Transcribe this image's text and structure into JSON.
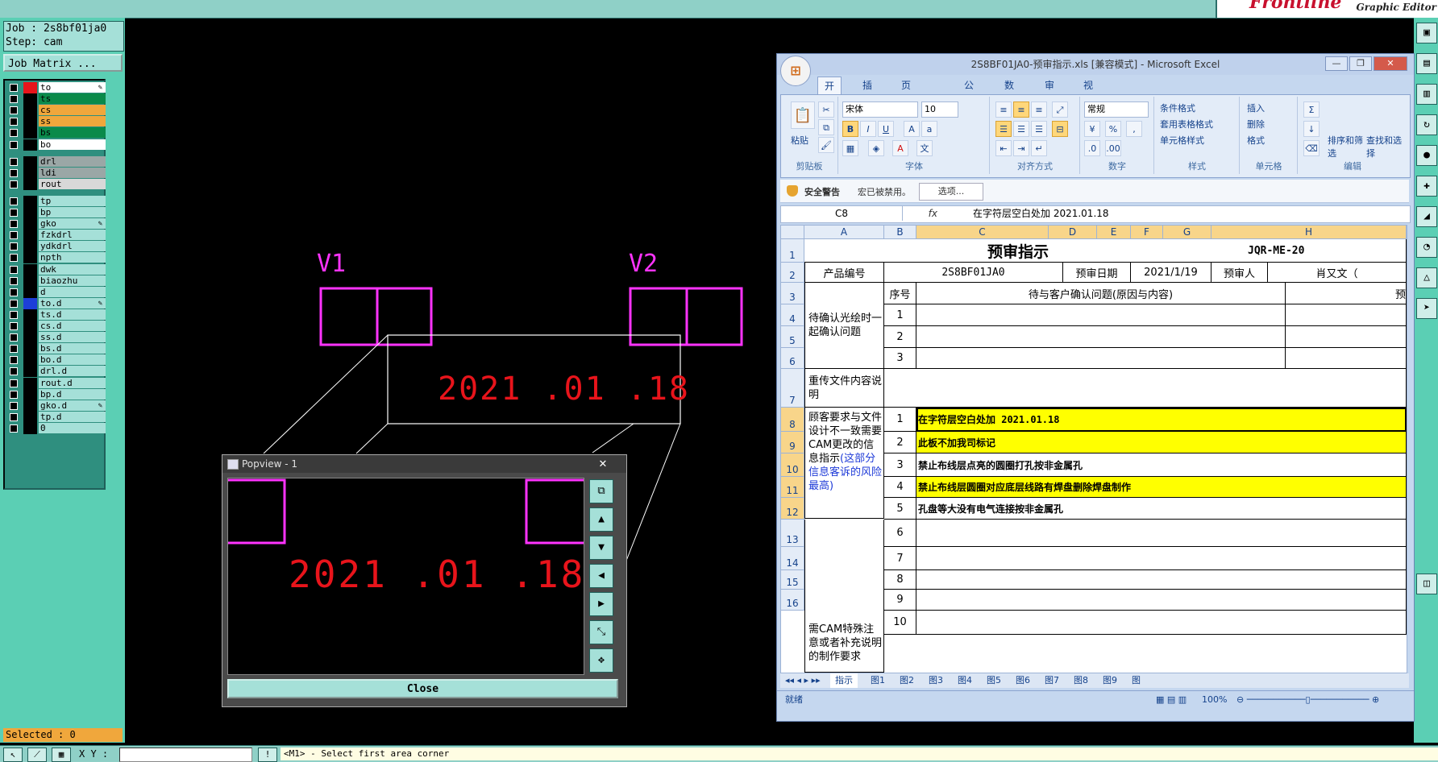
{
  "app": {
    "brand_logo": "Frontline",
    "brand_subtitle": "Graphic Editor"
  },
  "job": {
    "job_line": "Job : 2s8bf01ja0",
    "step_line": "Step: cam",
    "matrix_button": "Job Matrix ..."
  },
  "layers": [
    {
      "name": "to",
      "color": "#ffffff",
      "swatch": "#e8141b",
      "pen": true,
      "group": 0
    },
    {
      "name": "ts",
      "color": "#0a8a4a",
      "swatch": "#000",
      "pen": false,
      "group": 0
    },
    {
      "name": "cs",
      "color": "#f0a73c",
      "swatch": "#000",
      "pen": false,
      "group": 0
    },
    {
      "name": "ss",
      "color": "#f0a73c",
      "swatch": "#000",
      "pen": false,
      "group": 0
    },
    {
      "name": "bs",
      "color": "#0a8a4a",
      "swatch": "#000",
      "pen": false,
      "group": 0
    },
    {
      "name": "bo",
      "color": "#ffffff",
      "swatch": "#000",
      "pen": false,
      "group": 0
    },
    {
      "name": "drl",
      "color": "#9aa7a6",
      "swatch": "#000",
      "pen": false,
      "group": 1
    },
    {
      "name": "ldi",
      "color": "#9aa7a6",
      "swatch": "#000",
      "pen": false,
      "group": 1
    },
    {
      "name": "rout",
      "color": "#d8d8d8",
      "swatch": "#000",
      "pen": false,
      "group": 1
    },
    {
      "name": "tp",
      "color": "#a5e0d8",
      "swatch": "#000",
      "pen": false,
      "group": 2
    },
    {
      "name": "bp",
      "color": "#a5e0d8",
      "swatch": "#000",
      "pen": false,
      "group": 2
    },
    {
      "name": "gko",
      "color": "#a5e0d8",
      "swatch": "#000",
      "pen": true,
      "group": 2
    },
    {
      "name": "fzkdrl",
      "color": "#a5e0d8",
      "swatch": "#000",
      "pen": false,
      "group": 2
    },
    {
      "name": "ydkdrl",
      "color": "#a5e0d8",
      "swatch": "#000",
      "pen": false,
      "group": 2
    },
    {
      "name": "npth",
      "color": "#a5e0d8",
      "swatch": "#000",
      "pen": false,
      "group": 2
    },
    {
      "name": "dwk",
      "color": "#a5e0d8",
      "swatch": "#000",
      "pen": false,
      "group": 2
    },
    {
      "name": "biaozhu",
      "color": "#a5e0d8",
      "swatch": "#000",
      "pen": false,
      "group": 2
    },
    {
      "name": "d",
      "color": "#a5e0d8",
      "swatch": "#000",
      "pen": false,
      "group": 2
    },
    {
      "name": "to.d",
      "color": "#a5e0d8",
      "swatch": "#1d3fd8",
      "pen": true,
      "group": 2
    },
    {
      "name": "ts.d",
      "color": "#a5e0d8",
      "swatch": "#000",
      "pen": false,
      "group": 2
    },
    {
      "name": "cs.d",
      "color": "#a5e0d8",
      "swatch": "#000",
      "pen": false,
      "group": 2
    },
    {
      "name": "ss.d",
      "color": "#a5e0d8",
      "swatch": "#000",
      "pen": false,
      "group": 2
    },
    {
      "name": "bs.d",
      "color": "#a5e0d8",
      "swatch": "#000",
      "pen": false,
      "group": 2
    },
    {
      "name": "bo.d",
      "color": "#a5e0d8",
      "swatch": "#000",
      "pen": false,
      "group": 2
    },
    {
      "name": "drl.d",
      "color": "#a5e0d8",
      "swatch": "#000",
      "pen": false,
      "group": 2
    },
    {
      "name": "rout.d",
      "color": "#a5e0d8",
      "swatch": "#000",
      "pen": false,
      "group": 2
    },
    {
      "name": "bp.d",
      "color": "#a5e0d8",
      "swatch": "#000",
      "pen": false,
      "group": 2
    },
    {
      "name": "gko.d",
      "color": "#a5e0d8",
      "swatch": "#000",
      "pen": true,
      "group": 2
    },
    {
      "name": "tp.d",
      "color": "#a5e0d8",
      "swatch": "#000",
      "pen": false,
      "group": 2
    },
    {
      "name": "0",
      "color": "#a5e0d8",
      "swatch": "#000",
      "pen": false,
      "group": 2
    }
  ],
  "selected": "Selected : 0",
  "canvas": {
    "label_v1": "V1",
    "label_v2": "V2",
    "date_text": "2021 .01 .18"
  },
  "popview": {
    "title": "Popview - 1",
    "close_label": "Close",
    "date_text": "2021 .01 .18"
  },
  "bottom": {
    "xy_label": "X Y :",
    "message": "<M1> - Select first area corner"
  },
  "excel": {
    "title": "2S8BF01JA0-预审指示.xls  [兼容模式]  -  Microsoft Excel",
    "tabs": [
      "开始",
      "插入",
      "页面布局",
      "公式",
      "数据",
      "审阅",
      "视图"
    ],
    "font_name": "宋体",
    "font_size": "10",
    "number_format": "常规",
    "ribbon_groups": [
      "剪贴板",
      "字体",
      "对齐方式",
      "数字",
      "样式",
      "单元格",
      "编辑"
    ],
    "paste_label": "粘贴",
    "style_items": [
      "条件格式",
      "套用表格格式",
      "单元格样式"
    ],
    "cell_items": [
      "插入",
      "删除",
      "格式"
    ],
    "edit_items": [
      "排序和筛选",
      "查找和选择"
    ],
    "security_title": "安全警告",
    "security_text": "宏已被禁用。",
    "security_button": "选项...",
    "name_box": "C8",
    "formula": "在字符层空白处加 2021.01.18",
    "columns": [
      "A",
      "B",
      "C",
      "D",
      "E",
      "F",
      "G",
      "H"
    ],
    "rows": [
      "1",
      "2",
      "3",
      "4",
      "5",
      "6",
      "7",
      "8",
      "9",
      "10",
      "11",
      "12",
      "13",
      "14",
      "15",
      "16"
    ],
    "sheet": {
      "title": "预审指示",
      "doc_code": "JQR-ME-20",
      "product_label": "产品编号",
      "product_value": "2S8BF01JA0",
      "date_label": "预审日期",
      "date_value": "2021/1/19",
      "person_label": "预审人",
      "person_value": "肖又文（",
      "seq_header": "序号",
      "issue_header": "待与客户确认问题(原因与内容)",
      "pre_header": "预",
      "confirm_label": "待确认光绘时一起确认问题",
      "confirm_nums": [
        "1",
        "2",
        "3"
      ],
      "reupload_label": "重传文件内容说明",
      "mismatch_label_black": "顾客要求与文件设计不一致需要CAM更改的信息指示",
      "mismatch_label_blue": "(这部分信息客诉的风险最高)",
      "mismatch_rows": [
        {
          "n": "1",
          "text": "在字符层空白处加 2021.01.18",
          "yellow": true
        },
        {
          "n": "2",
          "text": "此板不加我司标记",
          "yellow": true
        },
        {
          "n": "3",
          "text": "禁止布线层点亮的圆圈打孔按非金属孔",
          "yellow": false
        },
        {
          "n": "4",
          "text": "禁止布线层圆圈对应底层线路有焊盘删除焊盘制作",
          "yellow": true
        },
        {
          "n": "5",
          "text": "孔盘等大没有电气连接按非金属孔",
          "yellow": false
        }
      ],
      "special_label": "需CAM特殊注意或者补充说明的制作要求",
      "special_nums": [
        "6",
        "7",
        "8",
        "9",
        "10"
      ]
    },
    "sheet_tabs": [
      "指示",
      "图1",
      "图2",
      "图3",
      "图4",
      "图5",
      "图6",
      "图7",
      "图8",
      "图9",
      "图"
    ],
    "status_ready": "就绪",
    "zoom": "100%"
  },
  "colors": {
    "magenta": "#ff33ff",
    "date_red": "#e8141b",
    "panel_teal": "#5bcfb4",
    "highlight_yellow": "#ffff00"
  }
}
